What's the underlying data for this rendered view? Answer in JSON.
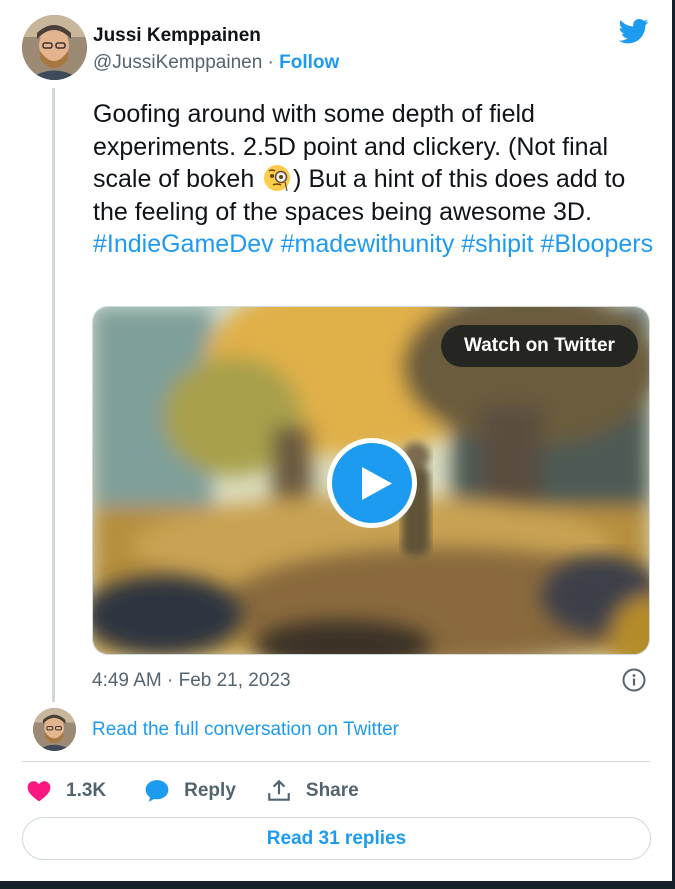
{
  "author": {
    "name": "Jussi Kemppainen",
    "handle": "@JussiKemppainen",
    "separator": "·",
    "follow_label": "Follow"
  },
  "tweet": {
    "text_part1": "Goofing around with some depth of field experiments. 2.5D point and clickery. (Not final scale of bokeh ",
    "emoji": "face-with-monocle",
    "text_part2": ") But a hint of this does add to the feeling of the spaces being awesome 3D. ",
    "hashtags": [
      "#IndieGameDev",
      "#madewithunity",
      "#shipit",
      "#Bloopers"
    ]
  },
  "media": {
    "watch_label": "Watch on Twitter",
    "play_icon": "play-icon"
  },
  "timestamp": "4:49 AM · Feb 21, 2023",
  "conversation_link": "Read the full conversation on Twitter",
  "actions": {
    "like_count": "1.3K",
    "reply_label": "Reply",
    "share_label": "Share"
  },
  "replies_button": "Read 31 replies",
  "icons": {
    "logo": "twitter-bird-icon",
    "info": "info-icon",
    "like": "heart-icon",
    "reply": "speech-bubble-icon",
    "share": "share-upload-icon"
  },
  "colors": {
    "accent": "#1d9bf0",
    "like": "#f91880",
    "text_secondary": "#536471"
  }
}
